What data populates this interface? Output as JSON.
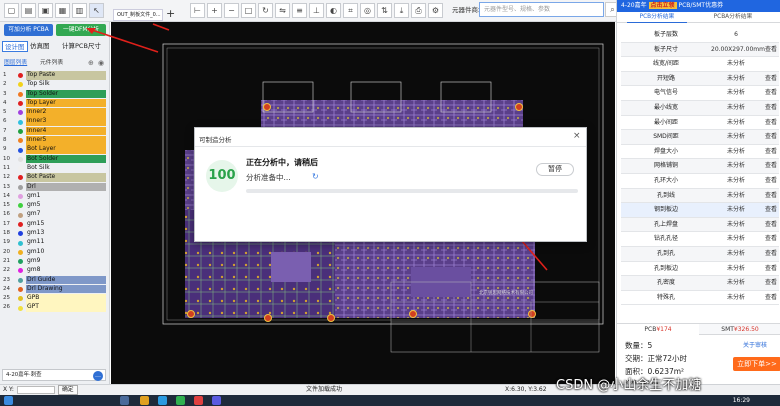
{
  "toolbar": {
    "file_tab": "OUT_制板文件_0...",
    "add_tab": "+",
    "search_label": "元器件商城",
    "search_placeholder": "元器件型号、规格、参数",
    "search_icon": "search-icon"
  },
  "left_panel": {
    "analyze_button": "可加分析 PCBA",
    "dfm_button": "一键DFM分析",
    "tabs": [
      "设计图",
      "仿真图",
      "计算PCB尺寸"
    ],
    "sub_tabs": [
      "图层列表",
      "元件列表"
    ],
    "layers": [
      {
        "num": "1",
        "name": "Top Paste",
        "dot": "#e02020",
        "bg": "#c8c6a0"
      },
      {
        "num": "2",
        "name": "Top Silk",
        "dot": "#f2d21a",
        "bg": ""
      },
      {
        "num": "3",
        "name": "Top Solder",
        "dot": "#f07820",
        "bg": "#2e9e58"
      },
      {
        "num": "4",
        "name": "Top Layer",
        "dot": "#e02020",
        "bg": "#f3b02a"
      },
      {
        "num": "5",
        "name": "Inner2",
        "dot": "#a040e0",
        "bg": "#f3b02a"
      },
      {
        "num": "6",
        "name": "Inner3",
        "dot": "#30c0e0",
        "bg": "#f3b02a"
      },
      {
        "num": "7",
        "name": "Inner4",
        "dot": "#20a040",
        "bg": "#f3b02a"
      },
      {
        "num": "8",
        "name": "Inner5",
        "dot": "#f08020",
        "bg": "#f3b02a"
      },
      {
        "num": "9",
        "name": "Bot Layer",
        "dot": "#2050e0",
        "bg": "#f3b02a"
      },
      {
        "num": "10",
        "name": "Bot Solder",
        "dot": "#e0e0e0",
        "bg": "#2e9e58"
      },
      {
        "num": "11",
        "name": "Bot Silk",
        "dot": "#f0f0f0",
        "bg": ""
      },
      {
        "num": "12",
        "name": "Bot Paste",
        "dot": "#e02020",
        "bg": "#c8c6a0"
      },
      {
        "num": "13",
        "name": "Drl",
        "dot": "#a0a0a0",
        "bg": "#b0b0b0"
      },
      {
        "num": "14",
        "name": "gm1",
        "dot": "#e0a0e0",
        "bg": ""
      },
      {
        "num": "15",
        "name": "gm5",
        "dot": "#40d040",
        "bg": ""
      },
      {
        "num": "16",
        "name": "gm7",
        "dot": "#c0a080",
        "bg": ""
      },
      {
        "num": "17",
        "name": "gm15",
        "dot": "#e02020",
        "bg": ""
      },
      {
        "num": "18",
        "name": "gm13",
        "dot": "#2040e0",
        "bg": ""
      },
      {
        "num": "19",
        "name": "gm11",
        "dot": "#30c0d0",
        "bg": ""
      },
      {
        "num": "20",
        "name": "gm10",
        "dot": "#f0b020",
        "bg": ""
      },
      {
        "num": "21",
        "name": "gm9",
        "dot": "#20a060",
        "bg": ""
      },
      {
        "num": "22",
        "name": "gm8",
        "dot": "#e020e0",
        "bg": ""
      },
      {
        "num": "23",
        "name": "Drl Guide",
        "dot": "#50a0a0",
        "bg": "#7f98c8"
      },
      {
        "num": "24",
        "name": "Drl Drawing",
        "dot": "#e06020",
        "bg": "#7f98c8"
      },
      {
        "num": "25",
        "name": "GPB",
        "dot": "#e0c020",
        "bg": "#fff6c0"
      },
      {
        "num": "26",
        "name": "GPT",
        "dot": "#f0e040",
        "bg": "#fff6c0"
      }
    ],
    "bottom_notice": "4-20嘉年·刺查"
  },
  "dialog": {
    "title": "可制造分析",
    "close": "×",
    "score": "100",
    "main_text": "正在分析中，请稍后",
    "sub_text": "分析准备中...",
    "pause": "暂停"
  },
  "right_panel": {
    "ad_prefix": "4-20嘉年",
    "ad_highlight": "点击立领",
    "ad_suffix": "PCB/SMT优惠券",
    "tabs": [
      "PCB分析结果",
      "PCBA分析结果"
    ],
    "rows": [
      {
        "name": "板子层数",
        "value": "6",
        "action": ""
      },
      {
        "name": "板子尺寸",
        "value": "20.00X297.00mm",
        "action": "查看"
      },
      {
        "name": "线宽/间距",
        "value": "未分析",
        "action": ""
      },
      {
        "name": "开短路",
        "value": "未分析",
        "action": "查看"
      },
      {
        "name": "电气信号",
        "value": "未分析",
        "action": "查看"
      },
      {
        "name": "最小线宽",
        "value": "未分析",
        "action": "查看"
      },
      {
        "name": "最小间距",
        "value": "未分析",
        "action": "查看"
      },
      {
        "name": "SMD间距",
        "value": "未分析",
        "action": "查看"
      },
      {
        "name": "焊盘大小",
        "value": "未分析",
        "action": "查看"
      },
      {
        "name": "网格铺铜",
        "value": "未分析",
        "action": "查看"
      },
      {
        "name": "孔环大小",
        "value": "未分析",
        "action": "查看"
      },
      {
        "name": "孔到线",
        "value": "未分析",
        "action": "查看"
      },
      {
        "name": "钢到板边",
        "value": "未分析",
        "action": "查看"
      },
      {
        "name": "孔上焊盘",
        "value": "未分析",
        "action": "查看"
      },
      {
        "name": "钻孔孔径",
        "value": "未分析",
        "action": "查看"
      },
      {
        "name": "孔到孔",
        "value": "未分析",
        "action": "查看"
      },
      {
        "name": "孔到板边",
        "value": "未分析",
        "action": "查看"
      },
      {
        "name": "孔密度",
        "value": "未分析",
        "action": "查看"
      },
      {
        "name": "特殊孔",
        "value": "未分析",
        "action": "查看"
      }
    ],
    "quote": {
      "pcb_label": "PCB",
      "pcb_price": "¥174",
      "smt_label": "SMT",
      "smt_price": "¥326.50",
      "quantity": "数量：5",
      "subscribe": "关于审核",
      "delivery": "交期：正常72小时",
      "area": "面积：0.6237m²",
      "price": "价格：¥174",
      "order_button": "立即下单>>"
    }
  },
  "status_bar": {
    "xy_label": "X Y:",
    "ok_button": "确定",
    "message": "文件加载成功",
    "coords": "X:6.30, Y:3.62"
  },
  "watermark": "CSDN @小山余生不加糖",
  "taskbar": {
    "clock": "16:29"
  },
  "canvas": {
    "title_block_company": "北京锐思网络技术有限公司"
  }
}
